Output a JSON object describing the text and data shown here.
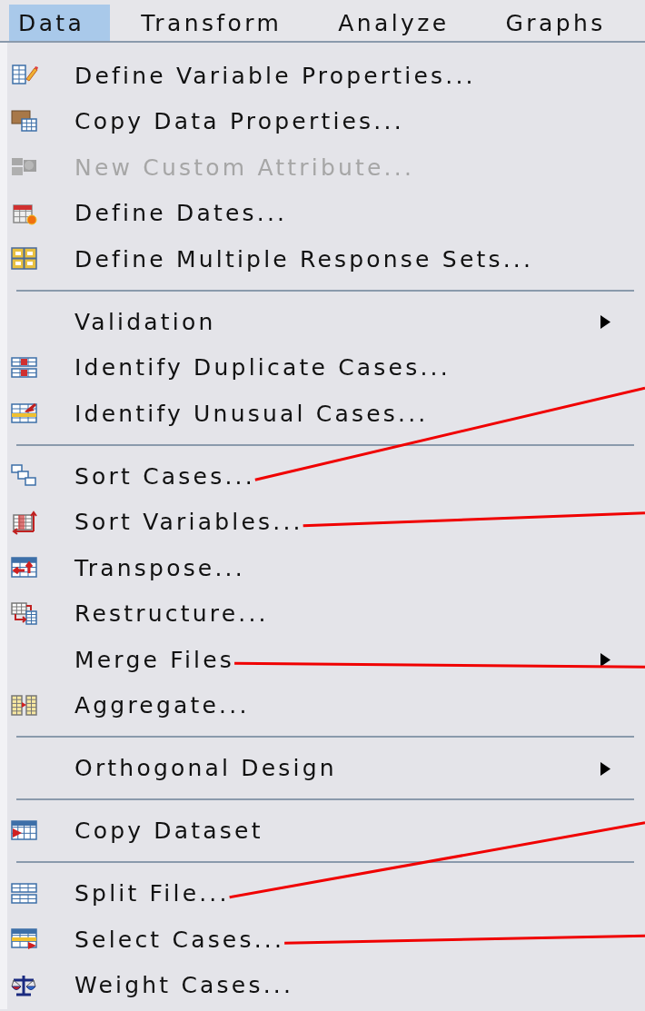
{
  "menu_bar": [
    {
      "label": "Data",
      "selected": true
    },
    {
      "label": "Transform",
      "selected": false
    },
    {
      "label": "Analyze",
      "selected": false
    },
    {
      "label": "Graphs",
      "selected": false
    }
  ],
  "menu": {
    "groups": [
      [
        {
          "label": "Define Variable Properties...",
          "disabled": false,
          "submenu": false,
          "annotated": false
        },
        {
          "label": "Copy Data Properties...",
          "disabled": false,
          "submenu": false,
          "annotated": false
        },
        {
          "label": "New Custom Attribute...",
          "disabled": true,
          "submenu": false,
          "annotated": false
        },
        {
          "label": "Define Dates...",
          "disabled": false,
          "submenu": false,
          "annotated": false
        },
        {
          "label": "Define Multiple Response Sets...",
          "disabled": false,
          "submenu": false,
          "annotated": false
        }
      ],
      [
        {
          "label": "Validation",
          "disabled": false,
          "submenu": true,
          "annotated": false
        },
        {
          "label": "Identify Duplicate Cases...",
          "disabled": false,
          "submenu": false,
          "annotated": false
        },
        {
          "label": "Identify Unusual Cases...",
          "disabled": false,
          "submenu": false,
          "annotated": false
        }
      ],
      [
        {
          "label": "Sort Cases...",
          "disabled": false,
          "submenu": false,
          "annotated": true
        },
        {
          "label": "Sort Variables...",
          "disabled": false,
          "submenu": false,
          "annotated": true
        },
        {
          "label": "Transpose...",
          "disabled": false,
          "submenu": false,
          "annotated": false
        },
        {
          "label": "Restructure...",
          "disabled": false,
          "submenu": false,
          "annotated": false
        },
        {
          "label": "Merge Files",
          "disabled": false,
          "submenu": true,
          "annotated": true
        },
        {
          "label": "Aggregate...",
          "disabled": false,
          "submenu": false,
          "annotated": false
        }
      ],
      [
        {
          "label": "Orthogonal Design",
          "disabled": false,
          "submenu": true,
          "annotated": false
        }
      ],
      [
        {
          "label": "Copy Dataset",
          "disabled": false,
          "submenu": false,
          "annotated": false
        }
      ],
      [
        {
          "label": "Split File...",
          "disabled": false,
          "submenu": false,
          "annotated": true
        },
        {
          "label": "Select Cases...",
          "disabled": false,
          "submenu": false,
          "annotated": true
        },
        {
          "label": "Weight Cases...",
          "disabled": false,
          "submenu": false,
          "annotated": false
        }
      ]
    ]
  }
}
